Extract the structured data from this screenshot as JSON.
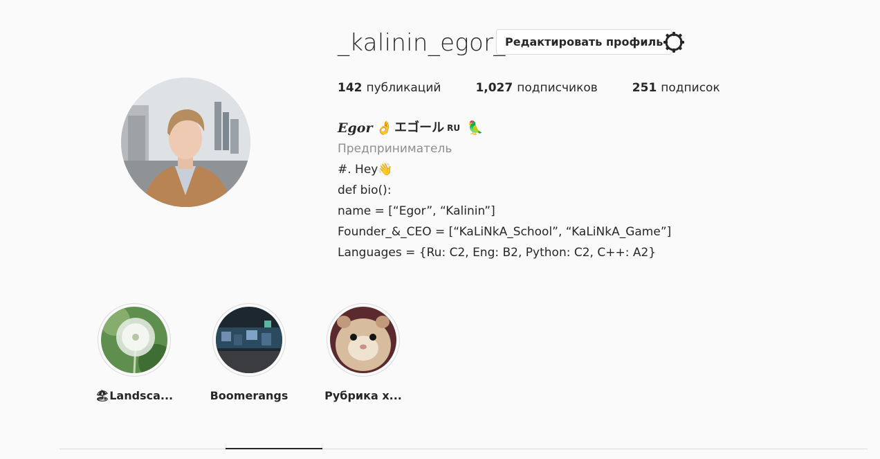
{
  "profile": {
    "username": "_kalinin_egor_",
    "edit_label": "Редактировать профиль",
    "settings_icon": "gear-icon"
  },
  "stats": {
    "posts_count": "142",
    "posts_label": "публикаций",
    "followers_count": "1,027",
    "followers_label": "подписчиков",
    "following_count": "251",
    "following_label": "подписок"
  },
  "bio": {
    "full_name": "Egor",
    "name_emoji": "👌",
    "name_japanese": "エゴール",
    "name_suffix": "RU",
    "parrot_emoji": "🦜",
    "category": "Предприниматель",
    "lines": [
      "#. Hey👋",
      "def bio():",
      "name = [“Egor”, “Kalinin”]",
      "Founder_&_CEO = [“KaLiNkA_School”, “KaLiNkA_Game”]",
      "Languages = {Ru: C2, Eng: B2, Python: C2, C++: A2}"
    ]
  },
  "highlights": [
    {
      "label": "🏖Landsca...",
      "icon": "dandelion-thumbnail"
    },
    {
      "label": "Boomerangs",
      "icon": "aquarium-thumbnail"
    },
    {
      "label": "Рубрика х...",
      "icon": "hamster-thumbnail"
    }
  ]
}
